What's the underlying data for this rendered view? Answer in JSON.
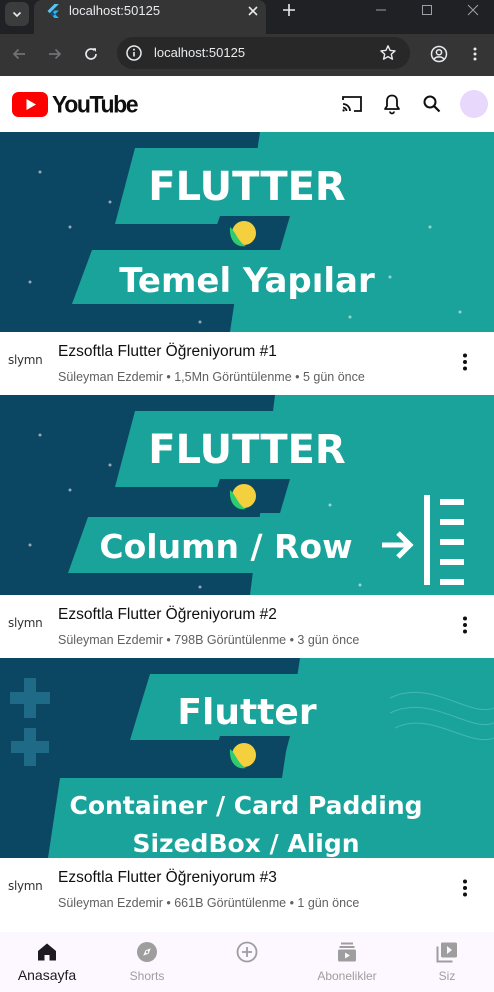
{
  "browser": {
    "tab_title": "localhost:50125",
    "url": "localhost:50125"
  },
  "app": {
    "logo_text": "YouTube",
    "brand_color": "#ff0000"
  },
  "videos": [
    {
      "channel_avatar_text": "slymn",
      "title": "Ezsoftla Flutter Öğreniyorum #1",
      "subtitle": "Süleyman Ezdemir • 1,5Mn Görüntülenme • 5 gün önce",
      "thumb_line1": "FLUTTER",
      "thumb_line2": "Temel Yapılar",
      "thumb_line3": ""
    },
    {
      "channel_avatar_text": "slymn",
      "title": "Ezsoftla Flutter Öğreniyorum #2",
      "subtitle": "Süleyman Ezdemir • 798B Görüntülenme • 3 gün önce",
      "thumb_line1": "FLUTTER",
      "thumb_line2": "Column / Row",
      "thumb_line3": ""
    },
    {
      "channel_avatar_text": "slymn",
      "title": "Ezsoftla Flutter Öğreniyorum #3",
      "subtitle": "Süleyman Ezdemir • 661B Görüntülenme • 1 gün önce",
      "thumb_line1": "Flutter",
      "thumb_line2": "Container / Card Padding",
      "thumb_line3": "SizedBox / Align"
    }
  ],
  "bottom_nav": [
    {
      "label": "Anasayfa",
      "icon": "home-icon",
      "active": true
    },
    {
      "label": "Shorts",
      "icon": "compass-icon",
      "active": false
    },
    {
      "label": "",
      "icon": "add-circle-icon",
      "active": false
    },
    {
      "label": "Abonelikler",
      "icon": "subscriptions-icon",
      "active": false
    },
    {
      "label": "Siz",
      "icon": "video-library-icon",
      "active": false
    }
  ],
  "colors": {
    "thumb_dark": "#0b4663",
    "thumb_teal": "#1aa39a",
    "nav_bg": "#fdf7ff"
  }
}
